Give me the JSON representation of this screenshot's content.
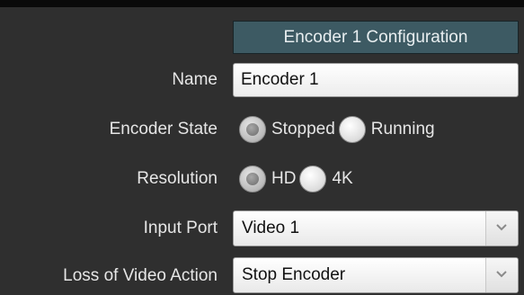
{
  "config": {
    "title": "Encoder 1 Configuration",
    "name_label": "Name",
    "name_value": "Encoder 1",
    "encoder_state_label": "Encoder State",
    "encoder_state_options": [
      "Stopped",
      "Running"
    ],
    "encoder_state_selected": "Stopped",
    "resolution_label": "Resolution",
    "resolution_options": [
      "HD",
      "4K"
    ],
    "resolution_selected": "HD",
    "input_port_label": "Input Port",
    "input_port_value": "Video 1",
    "loss_action_label": "Loss of Video Action",
    "loss_action_value": "Stop Encoder"
  },
  "colors": {
    "panel_background": "#2f2f2f",
    "header_background": "#3d5a63",
    "label_text": "#e6e6e6"
  }
}
